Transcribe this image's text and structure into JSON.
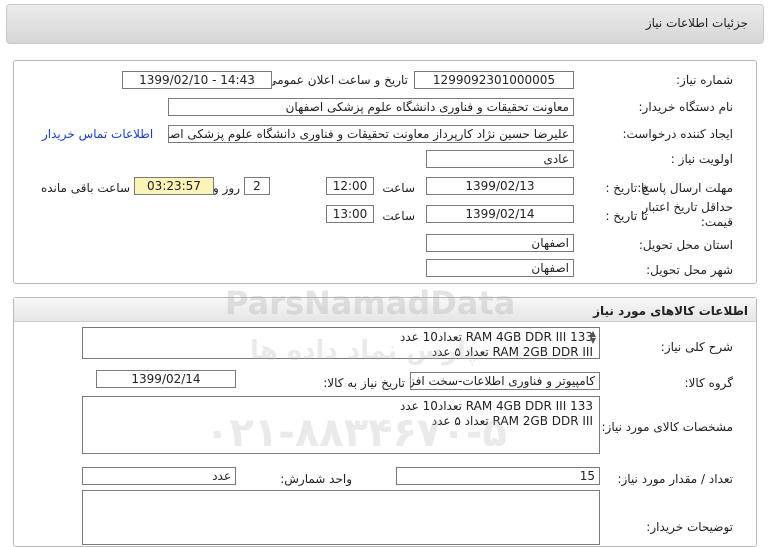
{
  "header": {
    "title": "جزئیات اطلاعات نیاز"
  },
  "need": {
    "need_number_label": "شماره نیاز:",
    "need_number": "1299092301000005",
    "announce_label": "تاریخ و ساعت اعلان عمومی:",
    "announce_value": "1399/02/10 - 14:43",
    "buyer_org_label": "نام دستگاه خریدار:",
    "buyer_org": "معاونت تحقیقات و فناوری دانشگاه علوم پزشکی اصفهان",
    "requester_label": "ایجاد کننده درخواست:",
    "requester": "علیرضا حسین نژاد کارپرداز معاونت تحقیقات و فناوری دانشگاه علوم پزشکی اصفهان",
    "contact_link": "اطلاعات تماس خریدار",
    "priority_label": "اولویت نیاز :",
    "priority": "عادی",
    "deadline_label": "مهلت ارسال پاسخ:",
    "to_date_label": "تا تاریخ :",
    "deadline_date": "1399/02/13",
    "time_label": "ساعت",
    "deadline_time": "12:00",
    "days_value": "2",
    "days_label": "روز و",
    "remaining_time": "03:23:57",
    "remaining_label": "ساعت باقی مانده",
    "validity_label": "حداقل تاریخ اعتبار قیمت:",
    "validity_to_label": "تا تاریخ :",
    "validity_date": "1399/02/14",
    "validity_time_label": "ساعت",
    "validity_time": "13:00",
    "province_label": "استان محل تحویل:",
    "province": "اصفهان",
    "city_label": "شهر محل تحویل:",
    "city": "اصفهان"
  },
  "goods": {
    "section_title": "اطلاعات کالاهای مورد نیاز",
    "summary_label": "شرح کلی نیاز:",
    "summary_line1": "133  RAM  4GB  DDR  III   تعداد10 عدد",
    "summary_line2": "RAM  2GB  DDR   III    تعداد ۵ عدد",
    "group_label": "گروه کالا:",
    "group_value": "کامپیوتر و فناوری اطلاعات-سخت افزار",
    "need_date_label": "تاریخ نیاز به کالا:",
    "need_date": "1399/02/14",
    "specs_label": "مشخصات کالای مورد نیاز:",
    "specs_line1": "133  RAM  4GB  DDR  III   تعداد10 عدد",
    "specs_line2": "RAM  2GB  DDR   III    تعداد ۵ عدد",
    "unit_label": "واحد شمارش:",
    "unit_value": "عدد",
    "qty_label": "تعداد / مقدار مورد نیاز:",
    "qty_value": "15",
    "buyer_notes_label": "توضیحات خریدار:",
    "buyer_notes": ""
  },
  "watermark": {
    "brand": "ParsNamadData",
    "persian": "پارس نماد داده ها",
    "phone": "۰۲۱-۸۸۳۴۶۷۰-۵"
  }
}
